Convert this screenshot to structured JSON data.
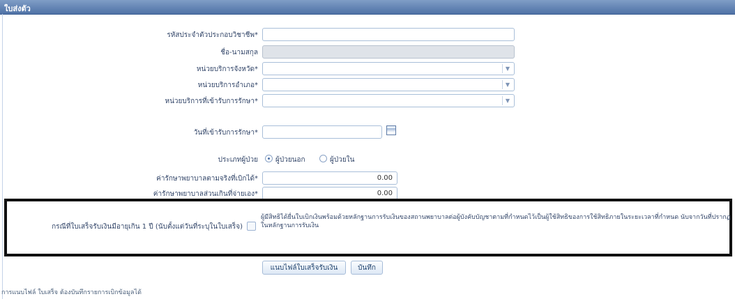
{
  "panel": {
    "title": "ใบส่งตัว"
  },
  "form": {
    "fields": {
      "hospital_code": {
        "label": "รหัสประจำตัวประกอบวิชาชีพ*",
        "value": ""
      },
      "patient_name": {
        "label": "ชื่อ-นามสกุล",
        "value": ""
      },
      "unit_province": {
        "label": "หน่วยบริการจังหวัด*",
        "value": ""
      },
      "unit_district": {
        "label": "หน่วยบริการอำเภอ*",
        "value": ""
      },
      "unit_service": {
        "label": "หน่วยบริการที่เข้ารับการรักษา*",
        "value": ""
      },
      "date_received": {
        "label": "วันที่เข้ารับการรักษา*",
        "value": ""
      },
      "patient_type": {
        "label": "ประเภทผู้ป่วย",
        "options": [
          "ผู้ป่วยนอก",
          "ผู้ป่วยใน"
        ],
        "selected": "ผู้ป่วยนอก"
      },
      "cost_claim": {
        "label": "ค่ารักษาพยาบาลตามจริงที่เบิกได้*",
        "value": "0.00"
      },
      "cost_extra": {
        "label": "ค่ารักษาพยาบาลส่วนเกินที่จ่ายเอง*",
        "value": "0.00"
      }
    },
    "checkbox": {
      "label": "กรณีที่ใบเสร็จรับเงินมีอายุเกิน 1 ปี (นับตั้งแต่วันที่ระบุในใบเสร็จ)",
      "note": "ผู้มีสิทธิได้ยื่นใบเบิกเงินพร้อมด้วยหลักฐานการรับเงินของสถานพยาบาลต่อผู้บังคับบัญชาตามที่กำหนดไว้เป็นผู้ใช้สิทธิของการใช้สิทธิภายในระยะเวลาที่กำหนด นับจากวันที่ปรากฏในหลักฐานการรับเงิน",
      "checked": false
    }
  },
  "buttons": {
    "attach": "แนบไฟล์ใบเสร็จรับเงิน",
    "save": "บันทึก"
  },
  "footer": {
    "note": "การแนบไฟล์ ใบเสร็จ ต้องบันทึกรายการเบิกข้อมูลได้"
  }
}
